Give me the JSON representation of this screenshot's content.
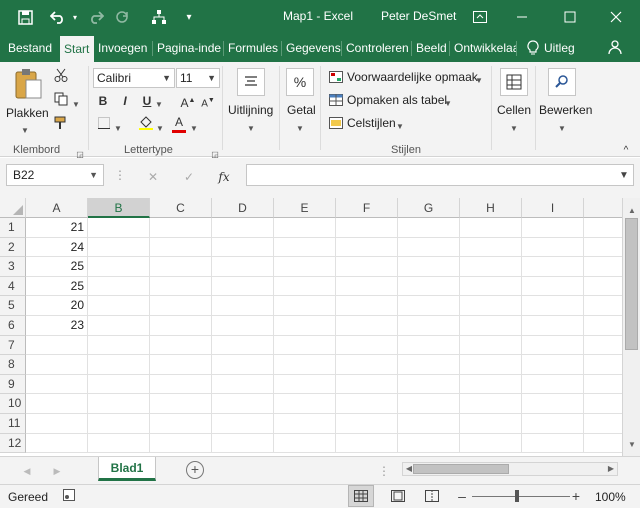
{
  "title_bar": {
    "document_title": "Map1 - Excel",
    "user_name": "Peter DeSmet"
  },
  "tabs": [
    {
      "label": "Bestand"
    },
    {
      "label": "Start"
    },
    {
      "label": "Invoegen"
    },
    {
      "label": "Pagina-inde"
    },
    {
      "label": "Formules"
    },
    {
      "label": "Gegevens"
    },
    {
      "label": "Controleren"
    },
    {
      "label": "Beeld"
    },
    {
      "label": "Ontwikkelaa"
    },
    {
      "label": "Uitleg"
    }
  ],
  "active_tab": "Start",
  "ribbon": {
    "clipboard": {
      "paste_label": "Plakken",
      "group_label": "Klembord"
    },
    "font": {
      "font_name": "Calibri",
      "font_size": "11",
      "group_label": "Lettertype"
    },
    "alignment": {
      "label": "Uitlijning"
    },
    "number": {
      "label": "Getal",
      "icon_text": "%"
    },
    "styles": {
      "conditional_formatting": "Voorwaardelijke opmaak",
      "format_as_table": "Opmaken als tabel",
      "cell_styles": "Celstijlen",
      "group_label": "Stijlen"
    },
    "cells": {
      "label": "Cellen"
    },
    "editing": {
      "label": "Bewerken"
    }
  },
  "formula_bar": {
    "name_box": "B22",
    "fx_label": "fx",
    "formula": ""
  },
  "sheet": {
    "columns": [
      "A",
      "B",
      "C",
      "D",
      "E",
      "F",
      "G",
      "H",
      "I"
    ],
    "rows": [
      "1",
      "2",
      "3",
      "4",
      "5",
      "6",
      "7",
      "8",
      "9",
      "10",
      "11",
      "12"
    ],
    "selected_column": "B",
    "column_a_values": [
      "21",
      "24",
      "25",
      "25",
      "20",
      "23"
    ]
  },
  "sheet_tabs": {
    "active": "Blad1"
  },
  "status_bar": {
    "status": "Gereed",
    "zoom": "100%"
  },
  "colors": {
    "excel_green": "#217346",
    "ribbon_bg": "#f3f3f3",
    "grid_line": "#e1e1e1"
  }
}
